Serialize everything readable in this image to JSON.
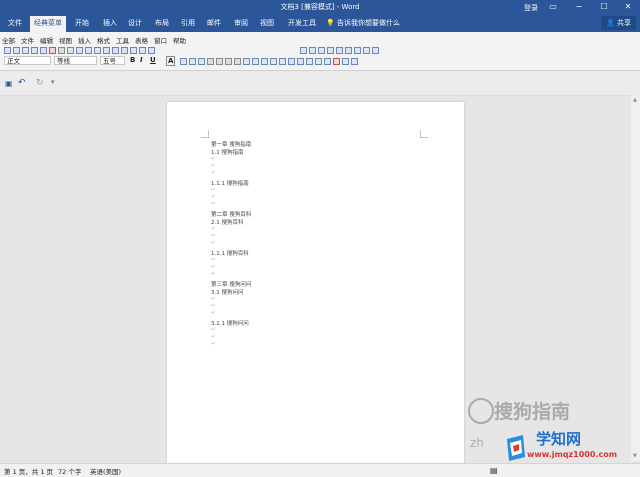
{
  "title_bar": {
    "title": "文档3 [兼容模式] - Word",
    "login": "登录",
    "ribbon_display_icon": "ribbon-display-icon",
    "minimize_icon": "minimize-icon",
    "maximize_icon": "maximize-icon",
    "close_icon": "close-icon"
  },
  "tabs": [
    "文件",
    "经典菜单",
    "开始",
    "插入",
    "设计",
    "布局",
    "引用",
    "邮件",
    "审阅",
    "视图",
    "开发工具"
  ],
  "active_tab": "经典菜单",
  "search_placeholder": "告诉我你想要做什么",
  "share_label": "共享",
  "classic_menu": [
    "全部",
    "文件",
    "编辑",
    "视图",
    "插入",
    "格式",
    "工具",
    "表格",
    "窗口",
    "帮助"
  ],
  "font": {
    "style": "正文",
    "name": "等线",
    "size": "五号"
  },
  "format_buttons": [
    "B",
    "I",
    "U",
    "A"
  ],
  "document": {
    "lines": [
      {
        "text": "第一章  搜狗指南"
      },
      {
        "text": "1.1 搜狗指南"
      },
      {
        "text": "1.1.1 搜狗指南"
      },
      {
        "text": "第二章  搜狗百科"
      },
      {
        "text": "2.1 搜狗百科"
      },
      {
        "text": "1.1.1 搜狗百科"
      },
      {
        "text": "第三章  搜狗问问"
      },
      {
        "text": "3.1 搜狗问问"
      },
      {
        "text": "3.1.1 搜狗问问"
      }
    ],
    "paragraph_mark": "↵"
  },
  "status": {
    "page": "第 1 页，共 1 页",
    "words": "72 个字",
    "language": "英语(美国)"
  },
  "watermarks": {
    "sogou": "搜狗指南",
    "site_name": "学知网",
    "site_url": "www.jmqz1000.com",
    "partial": "zh"
  },
  "colors": {
    "accent": "#2b579a",
    "ribbon_bg": "#f3f3f3",
    "page_bg": "#ffffff",
    "canvas_bg": "#e6e6e6"
  }
}
